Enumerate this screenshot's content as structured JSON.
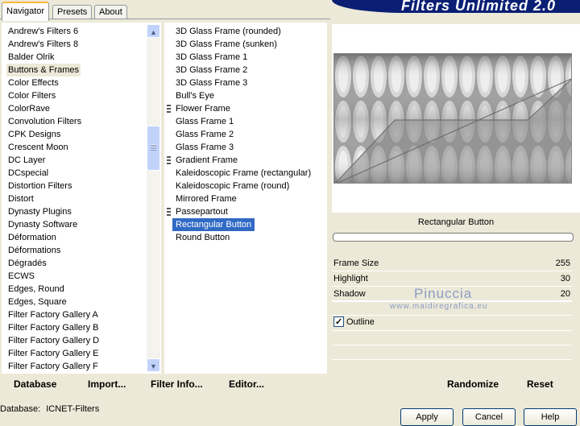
{
  "tabs": [
    "Navigator",
    "Presets",
    "About"
  ],
  "banner": {
    "title": "Filters Unlimited 2.0"
  },
  "categories": [
    "Andrew's Filters 6",
    "Andrew's Filters 8",
    "Balder Olrik",
    "Buttons & Frames",
    "Color Effects",
    "Color Filters",
    "ColorRave",
    "Convolution Filters",
    "CPK Designs",
    "Crescent Moon",
    "DC Layer",
    "DCspecial",
    "Distortion Filters",
    "Distort",
    "Dynasty Plugins",
    "Dynasty Software",
    "Déformation",
    "Déformations",
    "Dégradés",
    "ECWS",
    "Edges, Round",
    "Edges, Square",
    "Filter Factory Gallery A",
    "Filter Factory Gallery B",
    "Filter Factory Gallery D",
    "Filter Factory Gallery E",
    "Filter Factory Gallery F"
  ],
  "selected_category": "Buttons & Frames",
  "filters": [
    "3D Glass Frame (rounded)",
    "3D Glass Frame (sunken)",
    "3D Glass Frame 1",
    "3D Glass Frame 2",
    "3D Glass Frame 3",
    "Bull's Eye",
    "Flower Frame",
    "Glass Frame 1",
    "Glass Frame 2",
    "Glass Frame 3",
    "Gradient Frame",
    "Kaleidoscopic Frame (rectangular)",
    "Kaleidoscopic Frame (round)",
    "Mirrored Frame",
    "Passepartout",
    "Rectangular Button",
    "Round Button"
  ],
  "selected_filter": "Rectangular Button",
  "preview": {
    "filter_name": "Rectangular Button"
  },
  "params": [
    {
      "label": "Frame Size",
      "value": "255"
    },
    {
      "label": "Highlight",
      "value": "30"
    },
    {
      "label": "Shadow",
      "value": "20"
    }
  ],
  "outline": {
    "label": "Outline",
    "checked": true
  },
  "watermark": {
    "name": "Pinuccia",
    "url": "www.maidiregrafica.eu"
  },
  "commands": {
    "database": "Database",
    "import": "Import...",
    "filter_info": "Filter Info...",
    "editor": "Editor...",
    "randomize": "Randomize",
    "reset": "Reset"
  },
  "status": {
    "database_label": "Database:",
    "database_value": "ICNET-Filters"
  },
  "buttons": {
    "apply": "Apply",
    "cancel": "Cancel",
    "help": "Help"
  }
}
